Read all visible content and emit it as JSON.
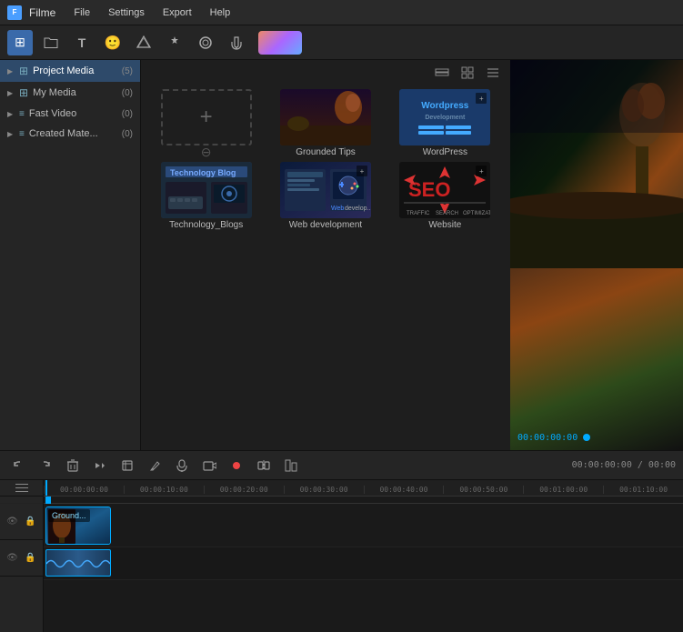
{
  "app": {
    "title": "Filme",
    "icon": "F"
  },
  "titlebar": {
    "menus": [
      "File",
      "Settings",
      "Export",
      "Help"
    ]
  },
  "toolbar": {
    "buttons": [
      {
        "name": "project-icon",
        "symbol": "⊞",
        "active": true
      },
      {
        "name": "folder-icon",
        "symbol": "📁",
        "active": false
      },
      {
        "name": "text-icon",
        "symbol": "T",
        "active": false
      },
      {
        "name": "emoji-icon",
        "symbol": "😊",
        "active": false
      },
      {
        "name": "filter-icon",
        "symbol": "⬡",
        "active": false
      },
      {
        "name": "effects-icon",
        "symbol": "✦",
        "active": false
      },
      {
        "name": "overlay-icon",
        "symbol": "⬢",
        "active": false
      },
      {
        "name": "audio-icon",
        "symbol": "♪",
        "active": false
      }
    ]
  },
  "sidebar": {
    "items": [
      {
        "label": "Project Media",
        "count": "(5)",
        "active": true
      },
      {
        "label": "My Media",
        "count": "(0)",
        "active": false
      },
      {
        "label": "Fast Video",
        "count": "(0)",
        "active": false
      },
      {
        "label": "Created Mate...",
        "count": "(0)",
        "active": false
      }
    ]
  },
  "media_toolbar": {
    "buttons": [
      {
        "name": "layers-icon",
        "symbol": "⬡"
      },
      {
        "name": "grid-icon",
        "symbol": "⊞"
      },
      {
        "name": "list-icon",
        "symbol": "≡"
      }
    ]
  },
  "media_items": [
    {
      "label": "",
      "type": "add"
    },
    {
      "label": "Grounded Tips",
      "type": "grounded"
    },
    {
      "label": "WordPress",
      "type": "wordpress"
    },
    {
      "label": "Technology_Blogs",
      "type": "techblogs"
    },
    {
      "label": "Web development",
      "type": "webdev"
    },
    {
      "label": "Website",
      "type": "seo"
    }
  ],
  "preview": {
    "timecode": "00:00:00:00"
  },
  "timeline_toolbar": {
    "undo_label": "↩",
    "redo_label": "↪",
    "delete_label": "🗑",
    "forward_label": "↻",
    "crop_label": "⊡",
    "draw_label": "✎",
    "mic_label": "🎤",
    "camera_label": "🎬",
    "record_label": "●",
    "split_label": "⊢",
    "chart_label": "▦",
    "timecode": "00:00:00:00 / 00:00"
  },
  "ruler_marks": [
    "00:00:00:00",
    "00:00:10:00",
    "00:00:20:00",
    "00:00:30:00",
    "00:00:40:00",
    "00:00:50:00",
    "00:01:00:00",
    "00:01:10:00"
  ],
  "clip": {
    "label": "Ground..."
  }
}
